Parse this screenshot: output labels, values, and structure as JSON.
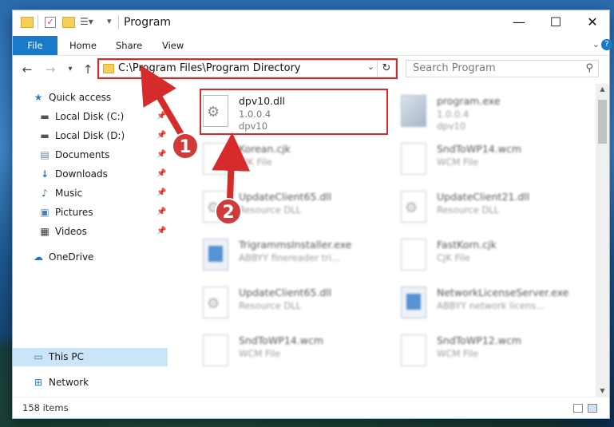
{
  "window": {
    "title": "Program",
    "controls": {
      "minimize": "—",
      "maximize": "☐",
      "close": "✕"
    }
  },
  "ribbon": {
    "tabs": [
      "File",
      "Home",
      "Share",
      "View"
    ]
  },
  "address": {
    "path": "C:\\Program Files\\Program Directory"
  },
  "search": {
    "placeholder": "Search Program"
  },
  "sidebar": {
    "items": [
      {
        "label": "Quick access",
        "icon": "star-icon"
      },
      {
        "label": "Local Disk (C:)",
        "icon": "drive-icon",
        "pinned": true
      },
      {
        "label": "Local Disk (D:)",
        "icon": "drive-icon",
        "pinned": true
      },
      {
        "label": "Documents",
        "icon": "documents-icon",
        "pinned": true
      },
      {
        "label": "Downloads",
        "icon": "downloads-icon",
        "pinned": true
      },
      {
        "label": "Music",
        "icon": "music-icon",
        "pinned": true
      },
      {
        "label": "Pictures",
        "icon": "pictures-icon",
        "pinned": true
      },
      {
        "label": "Videos",
        "icon": "videos-icon",
        "pinned": true
      },
      {
        "label": "OneDrive",
        "icon": "cloud-icon"
      },
      {
        "label": "This PC",
        "icon": "computer-icon",
        "selected": true
      },
      {
        "label": "Network",
        "icon": "network-icon"
      }
    ]
  },
  "files": [
    {
      "name": "dpv10.dll",
      "line2": "1.0.0.4",
      "line3": "dpv10",
      "icon": "dll-gear-icon",
      "highlighted": true
    },
    {
      "name": "program.exe",
      "line2": "1.0.0.4",
      "line3": "dpv10",
      "icon": "app-icon"
    },
    {
      "name": "Korean.cjk",
      "line2": "CJK File",
      "line3": "",
      "icon": "file-icon"
    },
    {
      "name": "SndToWP14.wcm",
      "line2": "WCM File",
      "line3": "",
      "icon": "file-icon"
    },
    {
      "name": "UpdateClient65.dll",
      "line2": "Resource DLL",
      "line3": "",
      "icon": "dll-gear-icon"
    },
    {
      "name": "UpdateClient21.dll",
      "line2": "Resource DLL",
      "line3": "",
      "icon": "dll-gear-icon"
    },
    {
      "name": "TrigrammsInstaller.exe",
      "line2": "ABBYY finereader tri...",
      "line3": "",
      "icon": "exe-icon"
    },
    {
      "name": "FastKorn.cjk",
      "line2": "CJK File",
      "line3": "",
      "icon": "file-icon"
    },
    {
      "name": "UpdateClient65.dll",
      "line2": "Resource DLL",
      "line3": "",
      "icon": "dll-gear-icon"
    },
    {
      "name": "NetworkLicenseServer.exe",
      "line2": "ABBYY network licens...",
      "line3": "",
      "icon": "exe-icon"
    },
    {
      "name": "SndToWP14.wcm",
      "line2": "WCM File",
      "line3": "",
      "icon": "file-icon"
    },
    {
      "name": "SndToWP12.wcm",
      "line2": "WCM File",
      "line3": "",
      "icon": "file-icon"
    }
  ],
  "status": {
    "item_count": "158 items"
  },
  "annotations": {
    "step1": "1",
    "step2": "2",
    "color": "#d62b2b"
  }
}
